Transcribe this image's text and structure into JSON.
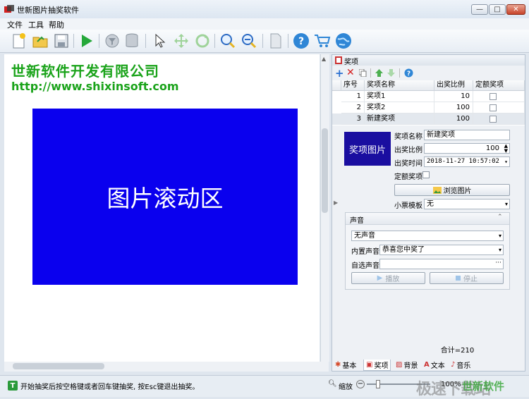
{
  "window": {
    "title": "世新图片抽奖软件",
    "min": "—",
    "max": "□",
    "close": "✕"
  },
  "menu": [
    "文件",
    "工具",
    "帮助"
  ],
  "canvas": {
    "company": "世新软件开发有限公司",
    "url": "http://www.shixinsoft.com",
    "scroll_area": "图片滚动区"
  },
  "panel": {
    "title": "奖项",
    "columns": [
      "序号",
      "奖项名称",
      "出奖比例",
      "定额奖项"
    ],
    "rows": [
      {
        "no": "1",
        "name": "奖项1",
        "ratio": "10"
      },
      {
        "no": "2",
        "name": "奖项2",
        "ratio": "100"
      },
      {
        "no": "3",
        "name": "新建奖项",
        "ratio": "100"
      }
    ],
    "prize_image": "奖项图片",
    "labels": {
      "name": "奖项名称",
      "ratio": "出奖比例",
      "time": "出奖时间",
      "fixed": "定额奖项",
      "ticket": "小票模板"
    },
    "values": {
      "name": "新建奖项",
      "ratio": "100",
      "time": "2018-11-27 10:57:02",
      "ticket": "无"
    },
    "browse": "浏览图片",
    "sound": {
      "title": "声音",
      "mode": "无声音",
      "builtin_label": "内置声音",
      "builtin_value": "恭喜您中奖了",
      "custom_label": "自选声音",
      "custom_value": "",
      "more": "···",
      "play": "播放",
      "stop": "停止"
    },
    "total": "合计=210",
    "tabs": [
      "基本",
      "奖项",
      "背景",
      "文本",
      "音乐"
    ]
  },
  "status": {
    "text": "开始抽奖后按空格键或者回车键抽奖, 按Esc键退出抽奖。",
    "zoom_label": "缩放",
    "zoom_value": "100%"
  },
  "watermark": {
    "site": "极速下载站",
    "brand": "世新软件"
  },
  "colors": {
    "canvas_blue": "#0a00ee",
    "company_green": "#1aa31a",
    "prize_image_bg": "#1a0ea0"
  }
}
